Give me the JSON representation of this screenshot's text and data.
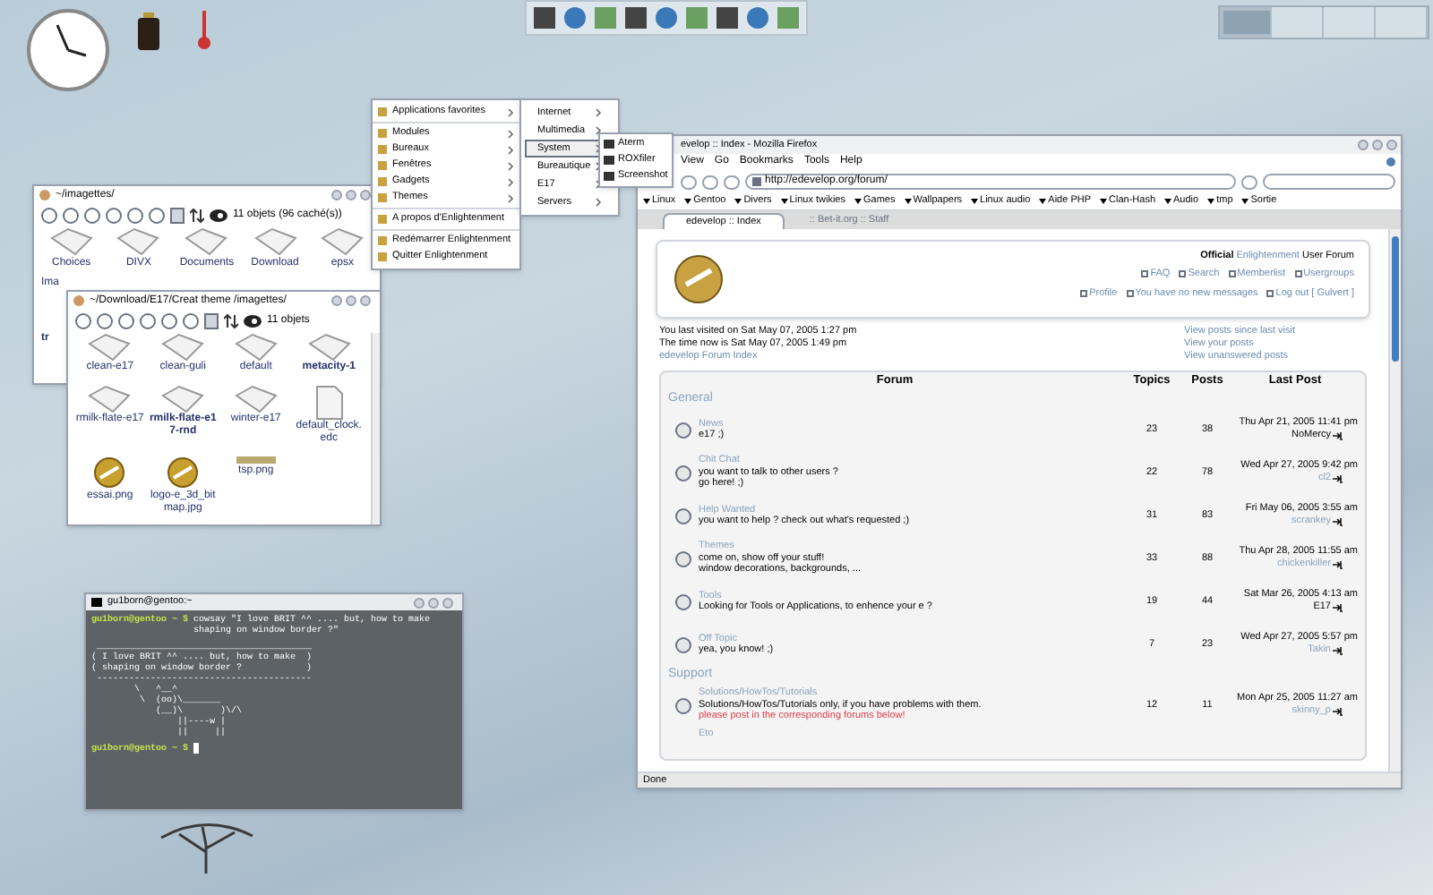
{
  "pager": {
    "desks": [
      {
        "selected": true
      },
      {
        "selected": false
      },
      {
        "selected": false
      },
      {
        "selected": false
      }
    ]
  },
  "main_menu": {
    "items": [
      {
        "kind": "item",
        "label": "Applications favorites",
        "submenu": true
      },
      {
        "kind": "separator"
      },
      {
        "kind": "item",
        "label": "Modules",
        "submenu": true
      },
      {
        "kind": "item",
        "label": "Bureaux",
        "submenu": true
      },
      {
        "kind": "item",
        "label": "Fenêtres",
        "submenu": true
      },
      {
        "kind": "item",
        "label": "Gadgets",
        "submenu": true
      },
      {
        "kind": "item",
        "label": "Themes",
        "submenu": true
      },
      {
        "kind": "separator"
      },
      {
        "kind": "item",
        "label": "A propos d'Enlightenment",
        "submenu": false
      },
      {
        "kind": "separator"
      },
      {
        "kind": "item",
        "label": "Redémarrer Enlightenment",
        "submenu": false
      },
      {
        "kind": "item",
        "label": "Quitter Enlightenment",
        "submenu": false
      }
    ]
  },
  "sub_menu": {
    "items": [
      {
        "label": "Internet",
        "selected": false
      },
      {
        "label": "Multimedia",
        "selected": false
      },
      {
        "label": "System",
        "selected": true
      },
      {
        "label": "Bureautique",
        "selected": false
      },
      {
        "label": "E17",
        "selected": false
      },
      {
        "label": "Servers",
        "selected": false
      }
    ]
  },
  "system_menu": {
    "items": [
      {
        "label": "Aterm"
      },
      {
        "label": "ROXfiler"
      },
      {
        "label": "Screenshot"
      }
    ]
  },
  "file_manager_back": {
    "title": "~/imagettes/",
    "status": "11 objets (96 caché(s))",
    "items": [
      {
        "label": "Choices",
        "bold": false
      },
      {
        "label": "DIVX",
        "bold": false
      },
      {
        "label": "Documents",
        "bold": false
      },
      {
        "label": "Download",
        "bold": false
      },
      {
        "label": "epsx",
        "bold": false
      }
    ],
    "covered_labels": [
      {
        "label": "Ima",
        "bold": false
      },
      {
        "label": "tr",
        "bold": true
      }
    ]
  },
  "file_manager_front": {
    "title": "~/Download/E17/Creat theme /imagettes/",
    "status": "11 objets",
    "items": [
      {
        "label": "clean-e17",
        "bold": false,
        "kind": "folder"
      },
      {
        "label": "clean-guli",
        "bold": false,
        "kind": "folder"
      },
      {
        "label": "default",
        "bold": false,
        "kind": "folder"
      },
      {
        "label": "metacity-1",
        "bold": true,
        "kind": "folder"
      },
      {
        "label": "rmilk-flate-e17",
        "bold": false,
        "kind": "folder"
      },
      {
        "label": "rmilk-flate-e17-rnd",
        "bold": true,
        "kind": "folder"
      },
      {
        "label": "winter-e17",
        "bold": false,
        "kind": "folder"
      },
      {
        "label": "default_clock.edc",
        "bold": false,
        "kind": "document"
      },
      {
        "label": "essai.png",
        "bold": false,
        "kind": "image"
      },
      {
        "label": "logo-e_3d_bitmap.jpg",
        "bold": false,
        "kind": "image"
      },
      {
        "label": "tsp.png",
        "bold": false,
        "kind": "strip"
      }
    ]
  },
  "terminal": {
    "title": "gu1born@gentoo:~",
    "lines": [
      {
        "kind": "prompt",
        "prompt": "gu1born@gentoo ~ $",
        "text": "cowsay \"I love BRIT ^^ .... but, how to make shaping on window border ?\""
      },
      {
        "kind": "output",
        "text": " ________________________________________\n( I love BRIT ^^ .... but, how to make  )\n( shaping on window border ?            )\n ----------------------------------------\n        \\   ^__^\n         \\  (oo)\\_______\n            (__)\\       )\\/\\\n                ||----w |\n                ||     ||"
      },
      {
        "kind": "prompt",
        "prompt": "gu1born@gentoo ~ $"
      }
    ]
  },
  "browser": {
    "title": "evelop :: Index - Mozilla Firefox",
    "menu": [
      "View",
      "Go",
      "Bookmarks",
      "Tools",
      "Help"
    ],
    "url": "http://edevelop.org/forum/",
    "bookmarks": [
      "Linux",
      "Gentoo",
      "Divers",
      "Linux twikies",
      "Games",
      "Wallpapers",
      "Linux audio",
      "Aide PHP",
      "Clan-Hash",
      "Audio",
      "tmp",
      "Sortie"
    ],
    "tabs": [
      {
        "label": "edevelop :: Index",
        "selected": true
      },
      {
        "label": ":: Bet-it.org :: Staff",
        "selected": false
      }
    ],
    "status": "Done",
    "page": {
      "site_title": "Official",
      "site_link": "Enlightenment",
      "site_suffix": "User Forum",
      "nav_1": [
        {
          "label": "FAQ"
        },
        {
          "label": "Search"
        },
        {
          "label": "Memberlist"
        },
        {
          "label": "Usergroups"
        }
      ],
      "nav_2": [
        {
          "label": "Profile"
        },
        {
          "label": "You have no new messages"
        },
        {
          "label": "Log out [ Gulvert ]"
        }
      ],
      "last_visit": "You last visited on Sat May 07, 2005 1:27 pm",
      "time_now": "The time now is Sat May 07, 2005 1:49 pm",
      "index_link": "edevelop Forum Index",
      "view_links": [
        "View posts since last visit",
        "View your posts",
        "View unanswered posts"
      ],
      "columns": [
        "Forum",
        "Topics",
        "Posts",
        "Last Post"
      ],
      "sections": [
        {
          "title": "General",
          "rows": [
            {
              "name": "News",
              "desc": [
                "e17 ;)"
              ],
              "topics": "23",
              "posts": "38",
              "date": "Thu Apr 21, 2005 11:41 pm",
              "user": "NoMercy",
              "user_link": false
            },
            {
              "name": "Chit Chat",
              "desc": [
                "you want to talk to other users ?",
                "go here! ;)"
              ],
              "topics": "22",
              "posts": "78",
              "date": "Wed Apr 27, 2005 9:42 pm",
              "user": "cl2",
              "user_link": true
            },
            {
              "name": "Help Wanted",
              "desc": [
                "you want to help ? check out what's requested ;)"
              ],
              "topics": "31",
              "posts": "83",
              "date": "Fri May 06, 2005 3:55 am",
              "user": "scrankey",
              "user_link": true
            },
            {
              "name": "Themes",
              "desc": [
                "come on, show off your stuff!",
                "window decorations, backgrounds, ..."
              ],
              "topics": "33",
              "posts": "88",
              "date": "Thu Apr 28, 2005 11:55 am",
              "user": "chickenkiller",
              "user_link": true
            },
            {
              "name": "Tools",
              "desc": [
                "Looking for Tools or Applications, to enhence your e ?"
              ],
              "topics": "19",
              "posts": "44",
              "date": "Sat Mar 26, 2005 4:13 am",
              "user": "E17",
              "user_link": false
            },
            {
              "name": "Off Topic",
              "desc": [
                "yea, you know! ;)"
              ],
              "topics": "7",
              "posts": "23",
              "date": "Wed Apr 27, 2005 5:57 pm",
              "user": "Takin",
              "user_link": true
            }
          ]
        },
        {
          "title": "Support",
          "rows": [
            {
              "name": "Solutions/HowTos/Tutorials",
              "desc": [
                "Solutions/HowTos/Tutorials only, if you have problems with them."
              ],
              "notice": "please post in the corresponding forums below!",
              "topics": "12",
              "posts": "11",
              "date": "Mon Apr 25, 2005 11:27 am",
              "user": "skinny_p",
              "user_link": true
            }
          ]
        }
      ],
      "cut_row": "Eto"
    }
  }
}
